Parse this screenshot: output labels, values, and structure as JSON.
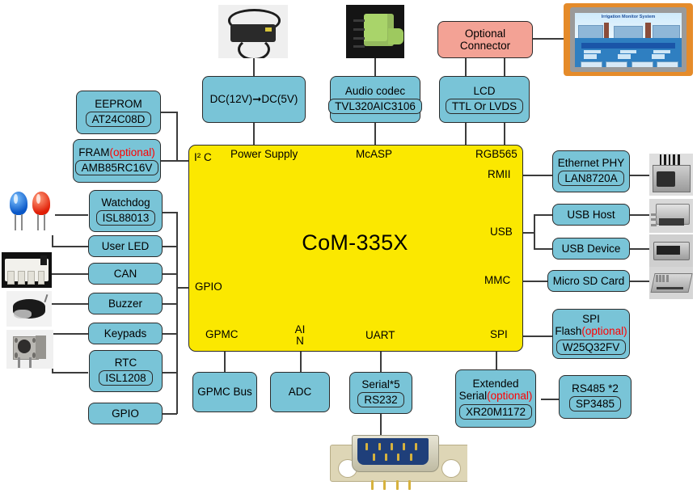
{
  "diagram": {
    "title": "CoM-335X system block diagram",
    "cpu": {
      "label": "CoM-335X"
    },
    "colors": {
      "box_fill": "#79c4d7",
      "cpu_fill": "#fbe800",
      "optional_red": "#ff0000",
      "pink_fill": "#f3a295",
      "line": "#3c3c3c"
    },
    "port_labels": [
      {
        "id": "i2c",
        "text": "I² C"
      },
      {
        "id": "power",
        "text": "Power Supply"
      },
      {
        "id": "mcasp",
        "text": "McASP"
      },
      {
        "id": "rgb565",
        "text": "RGB565"
      },
      {
        "id": "rmii",
        "text": "RMII"
      },
      {
        "id": "usb",
        "text": "USB"
      },
      {
        "id": "mmc",
        "text": "MMC"
      },
      {
        "id": "gpio",
        "text": "GPIO"
      },
      {
        "id": "gpmc",
        "text": "GPMC"
      },
      {
        "id": "ain",
        "text": "AI\nN"
      },
      {
        "id": "uart",
        "text": "UART"
      },
      {
        "id": "spi",
        "text": "SPI"
      }
    ],
    "blocks": {
      "eeprom": {
        "title": "EEPROM",
        "part": "AT24C08D"
      },
      "fram": {
        "title": "FRAM",
        "title_opt": "(optional)",
        "part": "AMB85RC16V"
      },
      "watchdog": {
        "title": "Watchdog",
        "part": "ISL88013"
      },
      "user_led": {
        "title": "User LED"
      },
      "can": {
        "title": "CAN"
      },
      "buzzer": {
        "title": "Buzzer"
      },
      "keypads": {
        "title": "Keypads"
      },
      "rtc": {
        "title": "RTC",
        "part": "ISL1208"
      },
      "gpio_blk": {
        "title": "GPIO"
      },
      "dcdc": {
        "title": "DC(12V)➞DC(5V)"
      },
      "audio": {
        "title": "Audio codec",
        "part": "TVL320AIC3106"
      },
      "lcd": {
        "title": "LCD",
        "part": "TTL Or LVDS"
      },
      "optional_connector": {
        "title": "Optional Connector"
      },
      "ethernet": {
        "title": "Ethernet PHY",
        "part": "LAN8720A"
      },
      "usb_host": {
        "title": "USB Host"
      },
      "usb_dev": {
        "title": "USB Device"
      },
      "microsd": {
        "title": "Micro SD Card"
      },
      "spi_flash": {
        "title_l1": "SPI",
        "title_l2": "Flash",
        "title_opt": "(optional)",
        "part": "W25Q32FV"
      },
      "gpmc_bus": {
        "title": "GPMC Bus"
      },
      "adc": {
        "title": "ADC"
      },
      "serial5": {
        "title": "Serial*5",
        "part": "RS232"
      },
      "ext_serial": {
        "title_l1": "Extended",
        "title_l2": "Serial",
        "title_opt": "(optional)",
        "part": "XR20M1172"
      },
      "rs485": {
        "title": "RS485 *2",
        "part": "SP3485"
      }
    },
    "photos": {
      "power_adapter": "power-adapter-photo",
      "audio_jack": "audio-jack-photo",
      "hmi_panel": {
        "name": "hmi-touch-panel-photo",
        "screen_title": "Irrigation Monitor System"
      },
      "leds": "blue-red-led-photo",
      "can_connector": "can-connector-photo",
      "buzzer": "buzzer-photo",
      "tact_switch": "tact-switch-photo",
      "rj45": "rj45-jack-photo",
      "usb_a": "usb-a-connector-photo",
      "mini_usb": "mini-usb-connector-photo",
      "micro_sd": "micro-sd-socket-photo",
      "db9": "db9-connector-photo"
    }
  }
}
